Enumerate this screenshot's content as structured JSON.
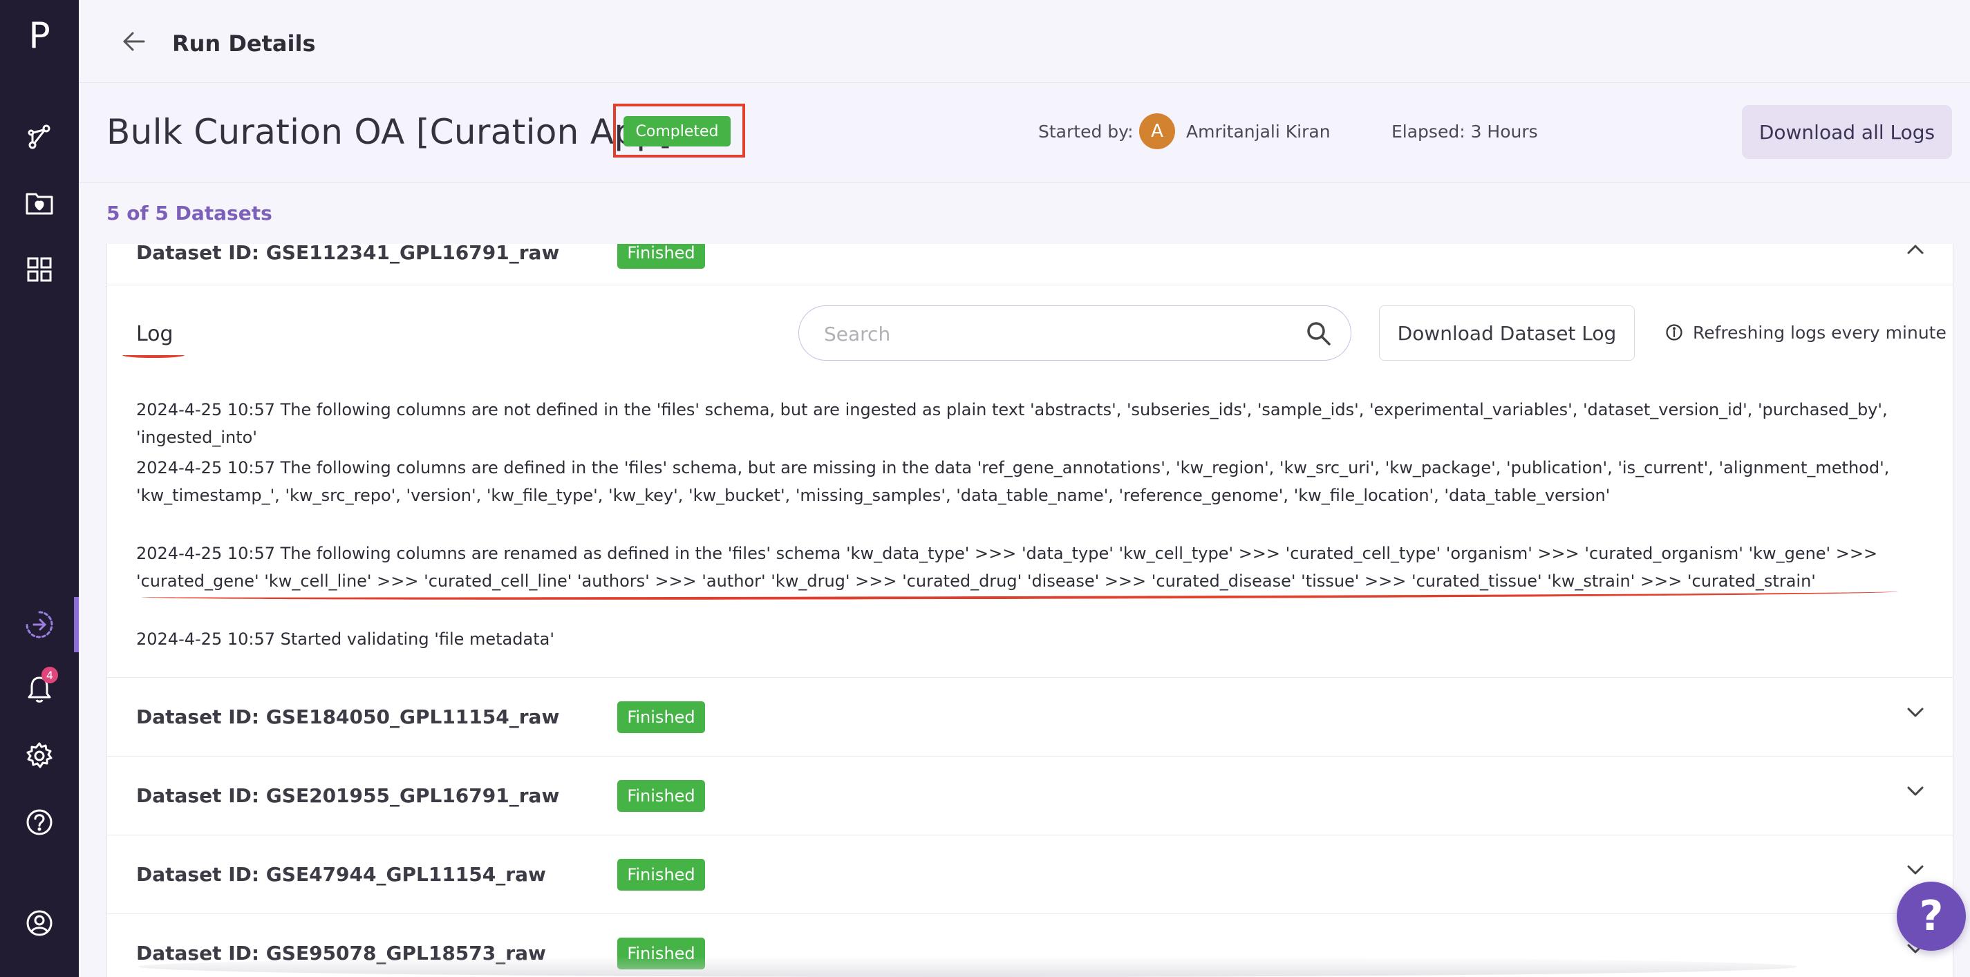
{
  "app": {
    "logo_letter": "P"
  },
  "sidebar": {
    "items": [
      {
        "name": "pipeline",
        "icon": "pipeline-icon"
      },
      {
        "name": "data",
        "icon": "folder-heart-icon"
      },
      {
        "name": "apps",
        "icon": "grid-icon"
      },
      {
        "name": "runs",
        "icon": "runs-icon",
        "active": true
      },
      {
        "name": "notifications",
        "icon": "bell-icon",
        "badge": "4"
      },
      {
        "name": "settings",
        "icon": "gear-icon"
      },
      {
        "name": "help",
        "icon": "question-circle-icon"
      },
      {
        "name": "account",
        "icon": "user-circle-icon"
      }
    ]
  },
  "header": {
    "title": "Run Details"
  },
  "run": {
    "name": "Bulk Curation OA [Curation App]",
    "status": "Completed",
    "started_by_label": "Started by:",
    "avatar_initial": "A",
    "started_by_name": "Amritanjali Kiran",
    "elapsed": "Elapsed: 3 Hours",
    "download_all_label": "Download all Logs"
  },
  "dataset_count": "5 of 5 Datasets",
  "datasets": [
    {
      "label": "Dataset ID: GSE112341_GPL16791_raw",
      "status": "Finished",
      "expanded": true
    },
    {
      "label": "Dataset ID: GSE184050_GPL11154_raw",
      "status": "Finished"
    },
    {
      "label": "Dataset ID: GSE201955_GPL16791_raw",
      "status": "Finished"
    },
    {
      "label": "Dataset ID: GSE47944_GPL11154_raw",
      "status": "Finished"
    },
    {
      "label": "Dataset ID: GSE95078_GPL18573_raw",
      "status": "Finished"
    }
  ],
  "log_panel": {
    "title": "Log",
    "search_placeholder": "Search",
    "download_label": "Download Dataset Log",
    "refresh_text": "Refreshing logs every minute",
    "lines": [
      "2024-4-25 10:57 The following columns are not defined in the 'files' schema, but are ingested as plain text 'abstracts', 'subseries_ids', 'sample_ids', 'experimental_variables', 'dataset_version_id', 'purchased_by', 'ingested_into'",
      "2024-4-25 10:57 The following columns are defined in the 'files' schema, but are missing in the data 'ref_gene_annotations', 'kw_region', 'kw_src_uri', 'kw_package', 'publication', 'is_current', 'alignment_method', 'kw_timestamp_', 'kw_src_repo', 'version', 'kw_file_type', 'kw_key', 'kw_bucket', 'missing_samples', 'data_table_name', 'reference_genome', 'kw_file_location', 'data_table_version'",
      "2024-4-25 10:57 The following columns are renamed as defined in the 'files' schema 'kw_data_type' >>> 'data_type' 'kw_cell_type' >>> 'curated_cell_type' 'organism' >>> 'curated_organism' 'kw_gene' >>> 'curated_gene' 'kw_cell_line' >>> 'curated_cell_line' 'authors' >>> 'author' 'kw_drug' >>> 'curated_drug' 'disease' >>> 'curated_disease' 'tissue' >>> 'curated_tissue' 'kw_strain' >>> 'curated_strain'",
      "2024-4-25 10:57 Started validating 'file metadata'"
    ]
  },
  "help_fab": {
    "label": "?"
  },
  "colors": {
    "sidebar_bg": "#221c33",
    "accent": "#7b5fb8",
    "status_green": "#45b346",
    "annotation_red": "#e0402e"
  }
}
